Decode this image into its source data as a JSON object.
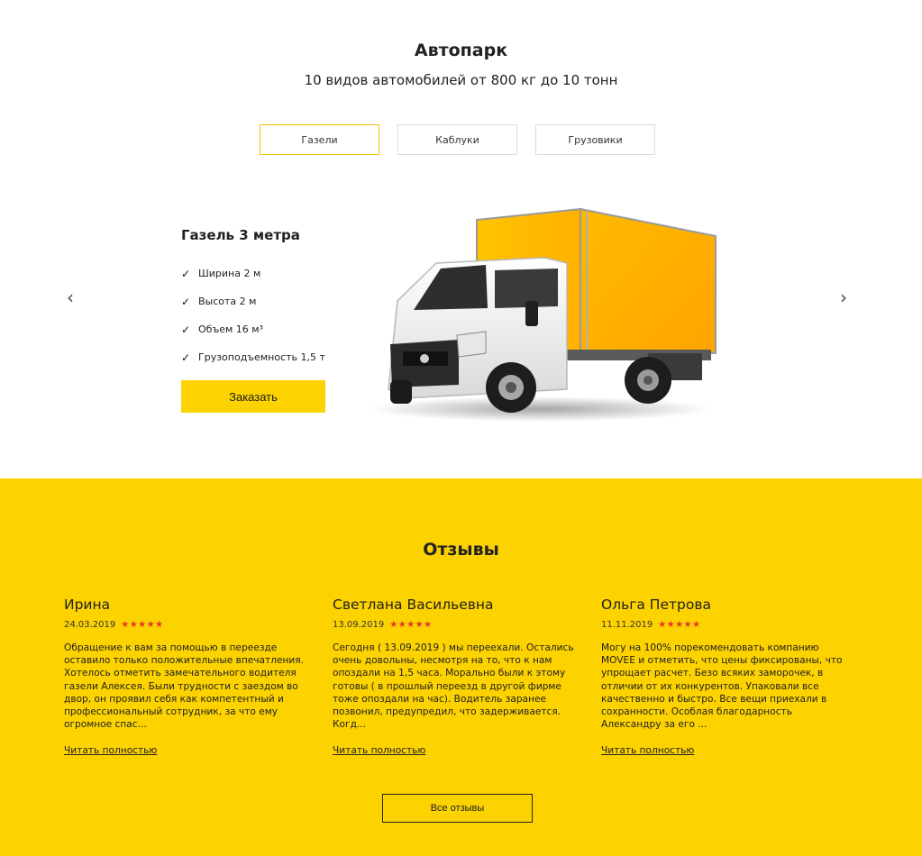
{
  "fleet": {
    "title": "Автопарк",
    "subtitle": "10 видов автомобилей от 800 кг до 10 тонн",
    "tabs": [
      {
        "label": "Газели",
        "active": true
      },
      {
        "label": "Каблуки",
        "active": false
      },
      {
        "label": "Грузовики",
        "active": false
      }
    ],
    "prev_arrow": "‹",
    "next_arrow": "›",
    "vehicle": {
      "name": "Газель 3 метра",
      "check": "✓",
      "specs": [
        "Ширина 2 м",
        "Высота 2 м",
        "Объем 16 м³",
        "Грузоподъемность 1,5 т"
      ],
      "order_label": "Заказать",
      "image_icon": "truck-illustration"
    }
  },
  "reviews": {
    "title": "Отзывы",
    "star_color": "#e8332a",
    "items": [
      {
        "name": "Ирина",
        "date": "24.03.2019",
        "stars": "★★★★★",
        "text": "Обращение к вам за помощью в переезде оставило только положительные впечатления. Хотелось отметить замечательного водителя газели Алексея. Были трудности с заездом во двор, он проявил себя как компетентный и профессиональный сотрудник, за что ему огромное спас...",
        "link": "Читать полностью"
      },
      {
        "name": "Светлана Васильевна",
        "date": "13.09.2019",
        "stars": "★★★★★",
        "text": "Сегодня ( 13.09.2019 ) мы переехали. Остались очень довольны, несмотря на то, что к нам опоздали на 1,5 часа. Морально были к этому готовы ( в прошлый переезд в другой фирме тоже опоздали на час). Водитель заранее позвонил, предупредил, что задерживается. Когд...",
        "link": "Читать полностью"
      },
      {
        "name": "Ольга Петрова",
        "date": "11.11.2019",
        "stars": "★★★★★",
        "text": "Могу на 100% порекомендовать компанию MOVEE и отметить, что цены фиксированы, что упрощает расчет. Безо всяких заморочек, в отличии от их конкурентов. Упаковали все качественно и быстро. Все вещи приехали в сохранности. Особлая благодарность Александру за его ...",
        "link": "Читать полностью"
      }
    ],
    "all_label": "Все отзывы"
  },
  "colors": {
    "accent": "#fcd200",
    "tab_active_border": "#f5c400"
  }
}
